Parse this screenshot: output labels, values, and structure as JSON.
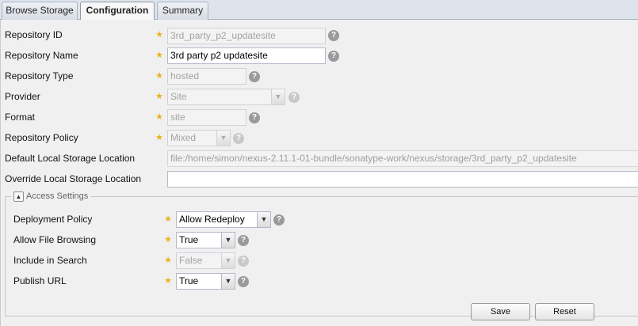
{
  "tabs": [
    {
      "label": "Browse Storage",
      "active": false
    },
    {
      "label": "Configuration",
      "active": true
    },
    {
      "label": "Summary",
      "active": false
    }
  ],
  "form": {
    "repository_id": {
      "label": "Repository ID",
      "value": "3rd_party_p2_updatesite"
    },
    "repository_name": {
      "label": "Repository Name",
      "value": "3rd party p2 updatesite"
    },
    "repository_type": {
      "label": "Repository Type",
      "value": "hosted"
    },
    "provider": {
      "label": "Provider",
      "value": "Site"
    },
    "format": {
      "label": "Format",
      "value": "site"
    },
    "repository_policy": {
      "label": "Repository Policy",
      "value": "Mixed"
    },
    "default_local_storage": {
      "label": "Default Local Storage Location",
      "value": "file:/home/simon/nexus-2.11.1-01-bundle/sonatype-work/nexus/storage/3rd_party_p2_updatesite"
    },
    "override_local_storage": {
      "label": "Override Local Storage Location",
      "value": ""
    }
  },
  "access_settings": {
    "legend": "Access Settings",
    "deployment_policy": {
      "label": "Deployment Policy",
      "value": "Allow Redeploy"
    },
    "allow_file_browsing": {
      "label": "Allow File Browsing",
      "value": "True"
    },
    "include_in_search": {
      "label": "Include in Search",
      "value": "False"
    },
    "publish_url": {
      "label": "Publish URL",
      "value": "True"
    }
  },
  "buttons": {
    "save": "Save",
    "reset": "Reset"
  },
  "icons": {
    "required": "star-icon",
    "help": "help-icon",
    "dropdown": "chevron-down-icon",
    "collapse": "collapse-icon"
  },
  "colors": {
    "required_star": "#e9b320",
    "help_icon": "#9a9a9a",
    "tab_bar": "#dfe4ec"
  }
}
